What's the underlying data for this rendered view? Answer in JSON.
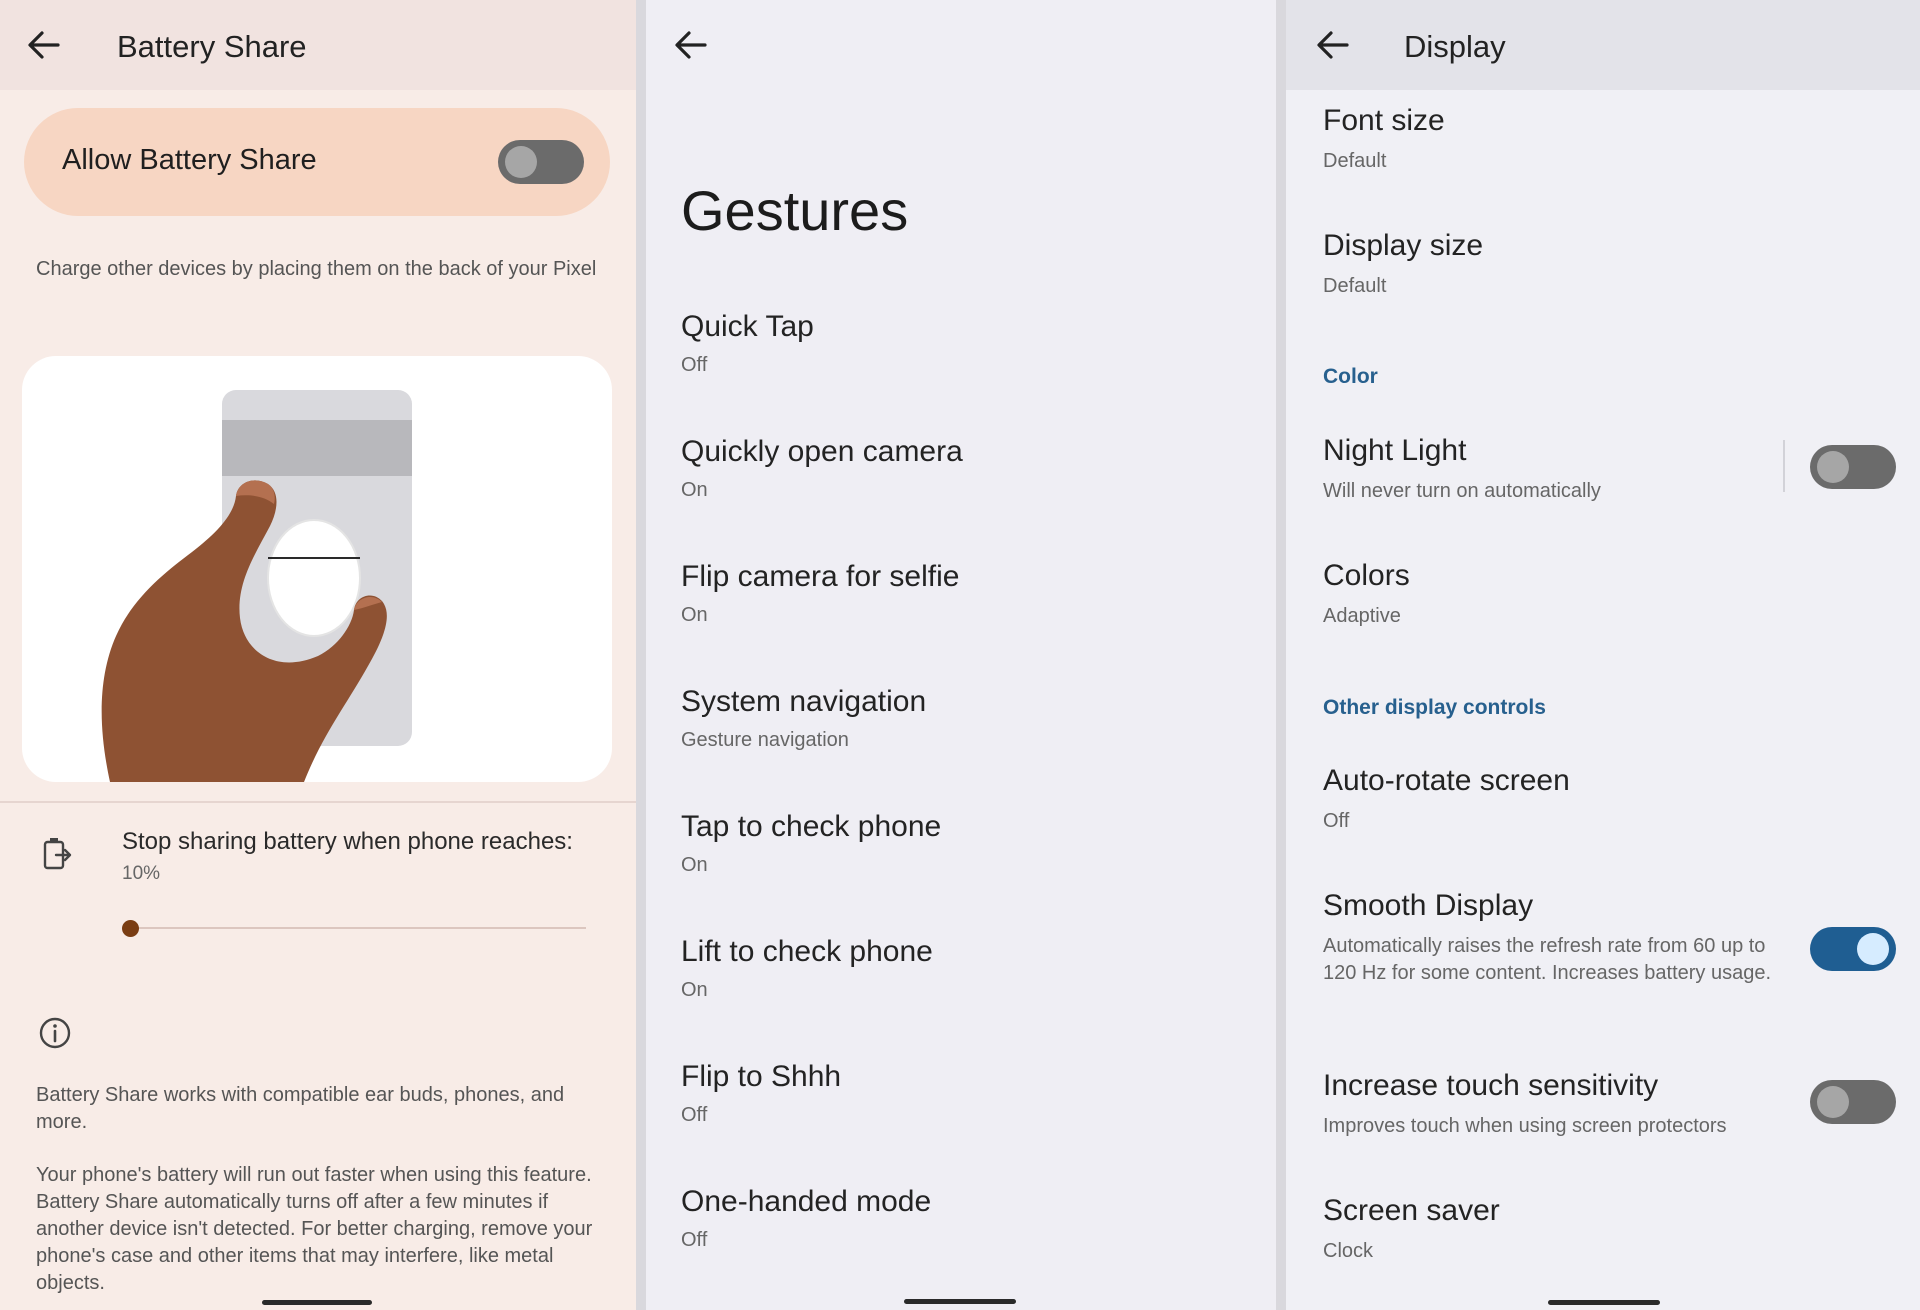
{
  "battery_share": {
    "title": "Battery Share",
    "allow_label": "Allow Battery Share",
    "allow_enabled": false,
    "description": "Charge other devices by placing them on the back of your Pixel",
    "stop_label": "Stop sharing battery when phone reaches:",
    "stop_value": "10%",
    "slider_percent": 10,
    "note_1": "Battery Share works with compatible ear buds, phones, and more.",
    "note_2": "Your phone's battery will run out faster when using this feature. Battery Share automatically turns off after a few minutes if another device isn't detected. For better charging, remove your phone's case and other items that may interfere, like metal objects.",
    "icons": {
      "back": "arrow-back-icon",
      "share": "battery-share-icon",
      "info": "info-icon"
    },
    "colors": {
      "card": "#f7d6c3",
      "accent": "#7a3d13",
      "background": "#f8ece7"
    }
  },
  "gestures": {
    "title": "Gestures",
    "items": [
      {
        "label": "Quick Tap",
        "value": "Off"
      },
      {
        "label": "Quickly open camera",
        "value": "On"
      },
      {
        "label": "Flip camera for selfie",
        "value": "On"
      },
      {
        "label": "System navigation",
        "value": "Gesture navigation"
      },
      {
        "label": "Tap to check phone",
        "value": "On"
      },
      {
        "label": "Lift to check phone",
        "value": "On"
      },
      {
        "label": "Flip to Shhh",
        "value": "Off"
      },
      {
        "label": "One-handed mode",
        "value": "Off"
      }
    ]
  },
  "display": {
    "title": "Display",
    "font_size": {
      "label": "Font size",
      "value": "Default"
    },
    "display_size": {
      "label": "Display size",
      "value": "Default"
    },
    "section_color": "Color",
    "night_light": {
      "label": "Night Light",
      "value": "Will never turn on automatically",
      "enabled": false
    },
    "colors": {
      "label": "Colors",
      "value": "Adaptive"
    },
    "section_other": "Other display controls",
    "auto_rotate": {
      "label": "Auto-rotate screen",
      "value": "Off"
    },
    "smooth_display": {
      "label": "Smooth Display",
      "value": "Automatically raises the refresh rate from 60 up to 120 Hz for some content. Increases battery usage.",
      "enabled": true
    },
    "touch_sensitivity": {
      "label": "Increase touch sensitivity",
      "value": "Improves touch when using screen protectors",
      "enabled": false
    },
    "screen_saver": {
      "label": "Screen saver",
      "value": "Clock"
    },
    "colors_theme": {
      "section": "#27608e",
      "toggle_on": "#1f5e92"
    }
  }
}
